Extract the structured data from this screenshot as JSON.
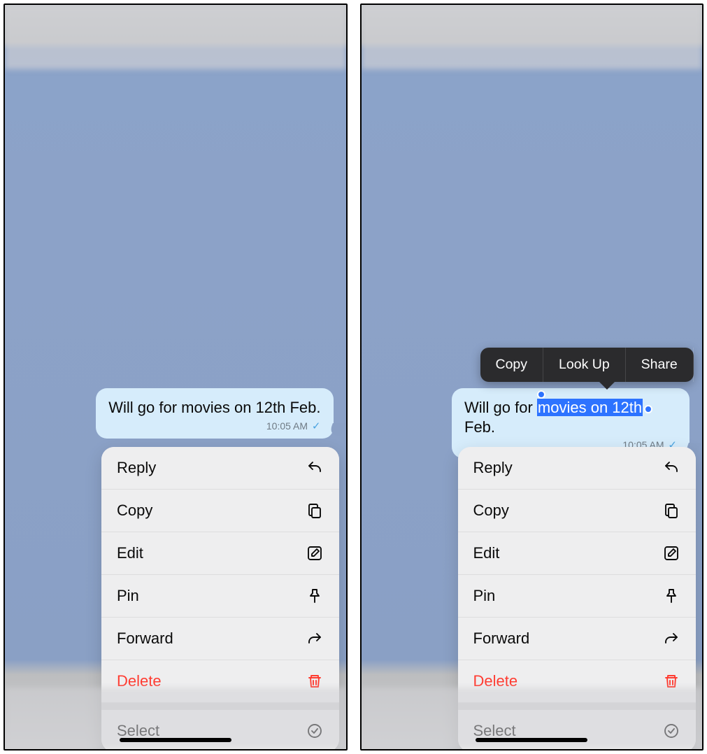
{
  "message": {
    "prefix": "Will go for ",
    "selected": "movies on 12th",
    "suffix": " Feb.",
    "full": "Will go for movies on 12th Feb.",
    "time": "10:05 AM",
    "time_right": "10:05 AM"
  },
  "callout": {
    "copy": "Copy",
    "lookup": "Look Up",
    "share": "Share"
  },
  "menu": {
    "reply": "Reply",
    "copy": "Copy",
    "edit": "Edit",
    "pin": "Pin",
    "forward": "Forward",
    "delete": "Delete",
    "select": "Select"
  }
}
